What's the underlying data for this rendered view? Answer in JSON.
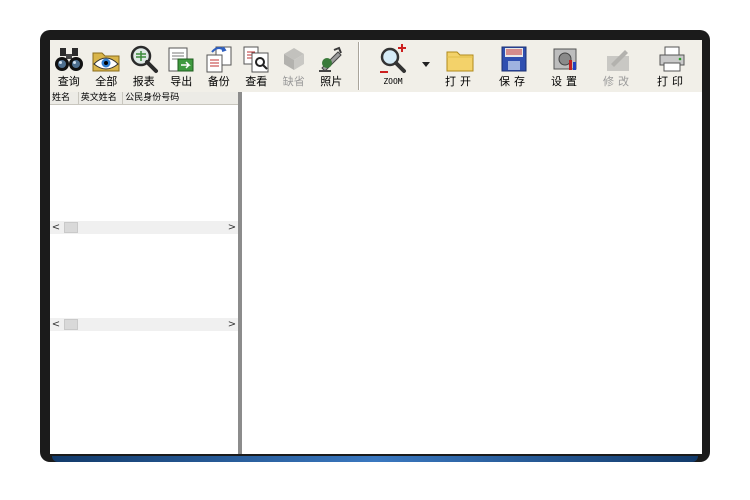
{
  "toolbar": {
    "left_buttons": [
      {
        "label": "查询",
        "icon": "binoculars-icon",
        "enabled": true
      },
      {
        "label": "全部",
        "icon": "eye-folder-icon",
        "enabled": true
      },
      {
        "label": "报表",
        "icon": "magnifier-report-icon",
        "enabled": true
      },
      {
        "label": "导出",
        "icon": "export-icon",
        "enabled": true
      },
      {
        "label": "备份",
        "icon": "backup-icon",
        "enabled": true
      },
      {
        "label": "查看",
        "icon": "view-document-icon",
        "enabled": true
      },
      {
        "label": "缺省",
        "icon": "default-icon",
        "enabled": false
      },
      {
        "label": "照片",
        "icon": "photo-icon",
        "enabled": true
      }
    ],
    "right_buttons": {
      "zoom": {
        "label": "ZOOM",
        "icon": "zoom-in-icon"
      },
      "open": {
        "label": "打开",
        "icon": "folder-open-icon"
      },
      "save": {
        "label": "保存",
        "icon": "save-icon"
      },
      "settings": {
        "label": "设置",
        "icon": "settings-icon"
      },
      "modify": {
        "label": "修改",
        "icon": "edit-icon",
        "enabled": false
      },
      "print": {
        "label": "打印",
        "icon": "printer-icon"
      }
    }
  },
  "grid": {
    "columns": [
      "姓名",
      "英文姓名",
      "公民身份号码"
    ]
  },
  "scrollbars": {
    "left_arrow": "<",
    "right_arrow": ">"
  }
}
